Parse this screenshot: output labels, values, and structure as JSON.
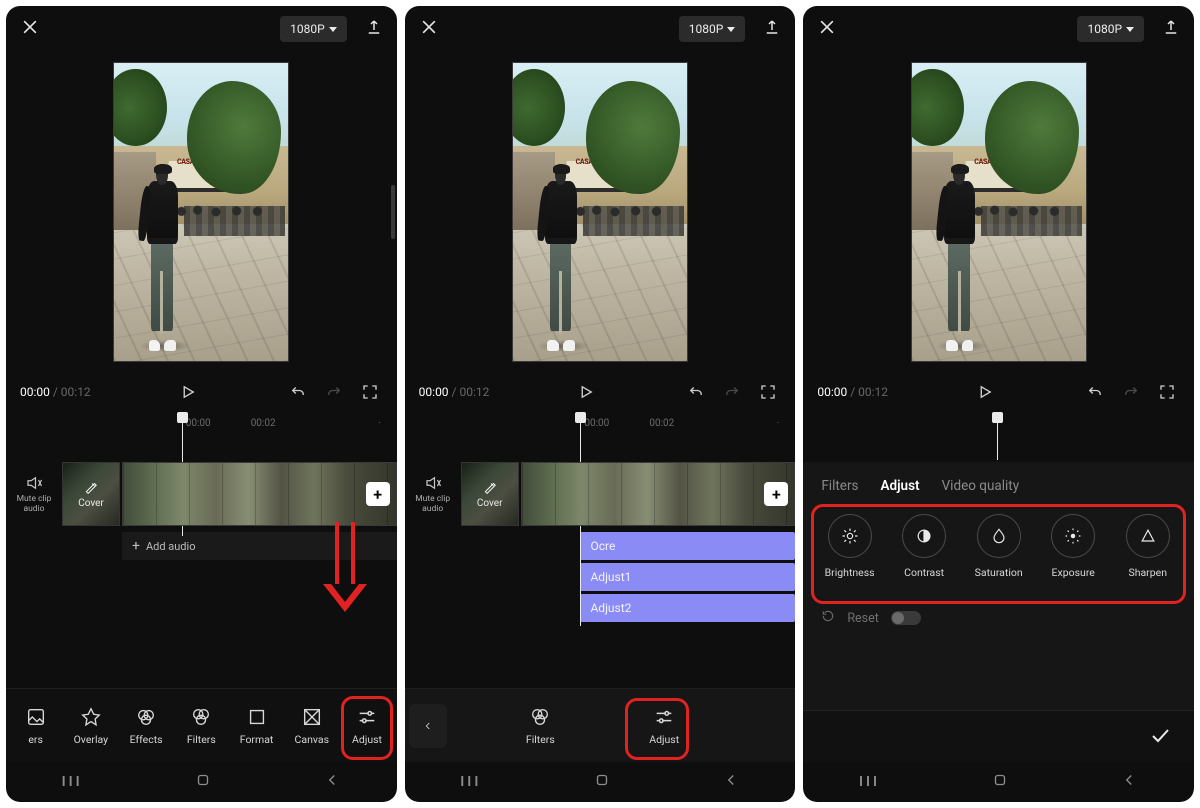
{
  "resolution_label": "1080P",
  "time": {
    "current": "00:00",
    "duration": "00:12"
  },
  "ruler": {
    "t0": "00:00",
    "t1": "00:02",
    "dot": "·"
  },
  "mute_clip_label": "Mute clip audio",
  "cover_label": "Cover",
  "add_audio_label": "Add audio",
  "sign_text": "CASA FON",
  "toolbar1": {
    "items": [
      {
        "key": "ers",
        "label": "ers"
      },
      {
        "key": "overlay",
        "label": "Overlay"
      },
      {
        "key": "effects",
        "label": "Effects"
      },
      {
        "key": "filters",
        "label": "Filters"
      },
      {
        "key": "format",
        "label": "Format"
      },
      {
        "key": "canvas",
        "label": "Canvas"
      },
      {
        "key": "adjust",
        "label": "Adjust"
      }
    ]
  },
  "toolbar2": {
    "filters_label": "Filters",
    "adjust_label": "Adjust"
  },
  "adjust_tracks": [
    "Ocre",
    "Adjust1",
    "Adjust2"
  ],
  "s3": {
    "tabs": {
      "filters": "Filters",
      "adjust": "Adjust",
      "video_quality": "Video quality"
    },
    "chips": [
      {
        "key": "brightness",
        "label": "Brightness"
      },
      {
        "key": "contrast",
        "label": "Contrast"
      },
      {
        "key": "saturation",
        "label": "Saturation"
      },
      {
        "key": "exposure",
        "label": "Exposure"
      },
      {
        "key": "sharpen",
        "label": "Sharpen"
      }
    ],
    "reset_label": "Reset"
  },
  "colors": {
    "accent_red": "#e02222",
    "track_purple": "#8b8bf6"
  }
}
